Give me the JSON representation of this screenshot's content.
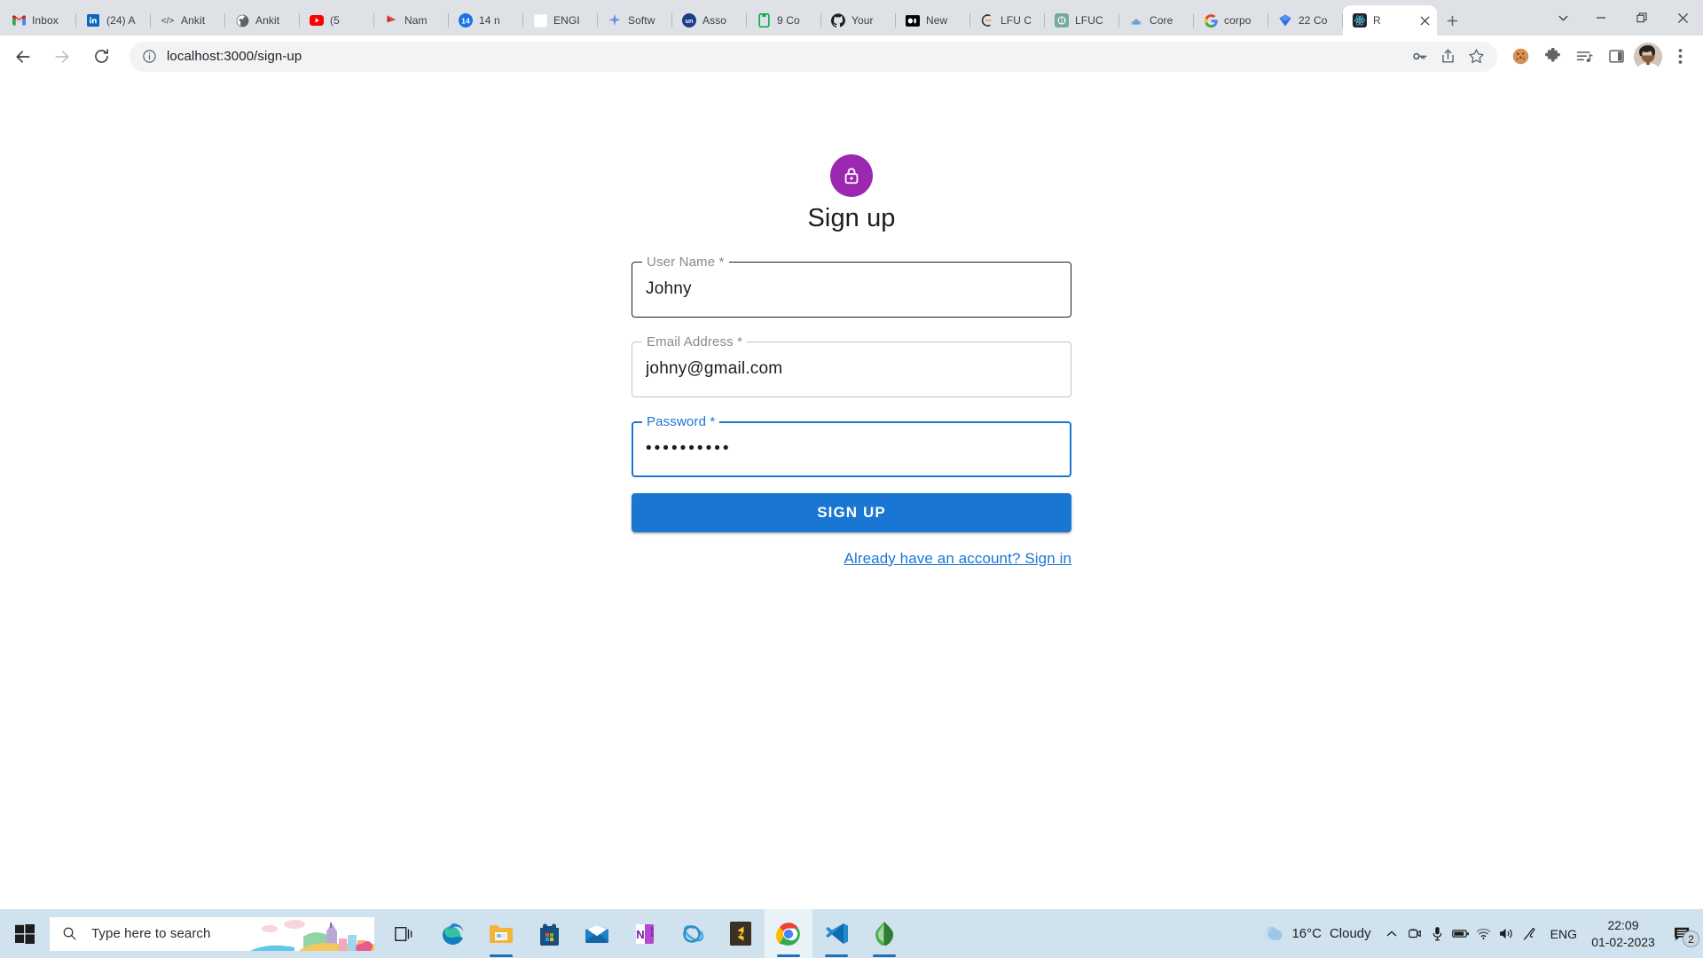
{
  "browser": {
    "tabs": [
      {
        "title": "Inbox",
        "favicon": "gmail-icon"
      },
      {
        "title": "(24) A",
        "favicon": "linkedin-icon"
      },
      {
        "title": "Ankit",
        "favicon": "code-icon"
      },
      {
        "title": "Ankit",
        "favicon": "globe-icon"
      },
      {
        "title": "(5",
        "favicon": "youtube-icon"
      },
      {
        "title": "Nam",
        "favicon": "redflag-icon"
      },
      {
        "title": "14 n",
        "favicon": "badge14-icon"
      },
      {
        "title": "ENGI",
        "favicon": "blank-icon"
      },
      {
        "title": "Softw",
        "favicon": "sparkle-icon"
      },
      {
        "title": "Asso",
        "favicon": "un-icon"
      },
      {
        "title": "9 Co",
        "favicon": "greenbook-icon"
      },
      {
        "title": "Your",
        "favicon": "github-icon"
      },
      {
        "title": "New",
        "favicon": "medium-icon"
      },
      {
        "title": "LFU C",
        "favicon": "lfu-icon"
      },
      {
        "title": "LFUC",
        "favicon": "openai-icon"
      },
      {
        "title": "Core",
        "favicon": "coursera-icon"
      },
      {
        "title": "corpo",
        "favicon": "google-icon"
      },
      {
        "title": "22 Co",
        "favicon": "diamond-icon"
      },
      {
        "title": "R",
        "favicon": "react-icon",
        "active": true
      }
    ],
    "new_tab_label": "+",
    "close_tab_label": "✕",
    "window_controls": {
      "tab_search": "tab-search-icon",
      "minimize": "minimize-icon",
      "restore": "restore-icon",
      "close": "close-icon"
    },
    "toolbar": {
      "back": "back-arrow-icon",
      "forward": "forward-arrow-icon",
      "reload": "reload-icon",
      "site_info": "info-circle-icon",
      "url": "localhost:3000/sign-up",
      "password_manager": "key-icon",
      "share": "share-icon",
      "bookmark": "star-icon",
      "cookie": "cookie-icon",
      "extensions": "puzzle-icon",
      "media": "media-playlist-icon",
      "side_panel": "side-panel-icon",
      "profile": "avatar",
      "menu": "three-dot-menu-icon"
    }
  },
  "page": {
    "lock_icon": "lock-icon",
    "title": "Sign up",
    "fields": [
      {
        "name": "user-name",
        "label": "User Name *",
        "value": "Johny",
        "state": "hovered",
        "type": "text"
      },
      {
        "name": "email-address",
        "label": "Email Address *",
        "value": "johny@gmail.com",
        "state": "default",
        "type": "text"
      },
      {
        "name": "password",
        "label": "Password *",
        "value": "••••••••••",
        "state": "focused",
        "type": "password"
      }
    ],
    "submit_label": "SIGN UP",
    "signin_link": "Already have an account? Sign in",
    "colors": {
      "avatar": "#9c27b0",
      "primary": "#1976d2",
      "outline_default": "#c4c4c4",
      "outline_hover": "#1d1d1d"
    }
  },
  "taskbar": {
    "start": "windows-start-icon",
    "search_placeholder": "Type here to search",
    "search_icon": "search-icon",
    "task_view": "task-view-icon",
    "apps": [
      {
        "name": "edge",
        "label": "Microsoft Edge",
        "running": false
      },
      {
        "name": "file-explorer",
        "label": "File Explorer",
        "running": true
      },
      {
        "name": "microsoft-store",
        "label": "Microsoft Store",
        "running": false
      },
      {
        "name": "mail",
        "label": "Mail",
        "running": false
      },
      {
        "name": "onenote",
        "label": "OneNote",
        "running": false
      },
      {
        "name": "internet-explorer",
        "label": "Internet Explorer",
        "running": false
      },
      {
        "name": "sublime-text",
        "label": "Sublime Text",
        "running": false
      },
      {
        "name": "chrome",
        "label": "Google Chrome",
        "running": true,
        "active": true
      },
      {
        "name": "vscode",
        "label": "Visual Studio Code",
        "running": true
      },
      {
        "name": "mongodb-compass",
        "label": "MongoDB Compass",
        "running": true
      }
    ],
    "tray": {
      "weather_icon": "cloud-icon",
      "temperature": "16°C",
      "condition": "Cloudy",
      "show_hidden": "chevron-up-icon",
      "icons": [
        "camera-icon",
        "microphone-icon",
        "battery-icon",
        "wifi-icon",
        "speaker-icon",
        "bluetooth-pen-icon"
      ],
      "language": "ENG",
      "time": "22:09",
      "date": "01-02-2023",
      "notifications_icon": "notification-icon",
      "notifications_count": "2"
    }
  }
}
